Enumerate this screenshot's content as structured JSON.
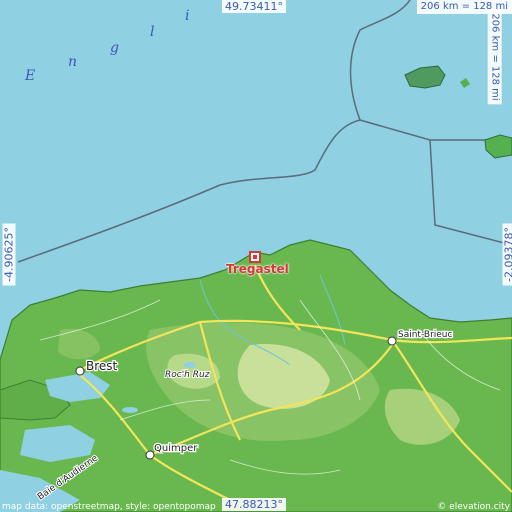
{
  "map": {
    "sea_label_letters": [
      "E",
      "n",
      "g",
      "l",
      "i"
    ],
    "coords": {
      "north": "49.73411°",
      "south": "47.88213°",
      "west": "-4.90625°",
      "east": "-2.09378°"
    },
    "scale": {
      "horizontal": "206 km = 128 mi",
      "vertical": "206 km = 128 mi"
    },
    "places": [
      {
        "name": "Brest"
      },
      {
        "name": "Quimper"
      },
      {
        "name": "Saint-Brieuc"
      },
      {
        "name": "Roc'h Ruz"
      },
      {
        "name": "Baie d'Audierne"
      }
    ],
    "highlight": {
      "name": "Tregastel"
    },
    "attribution": {
      "left": "map data: openstreetmap, style: opentopomap",
      "right": "© elevation.city"
    },
    "colors": {
      "sea": "#8fd0e2",
      "land_low": "#5fb24a",
      "land_mid": "#8cc468",
      "land_high": "#c9e09a",
      "road": "#f3e55a",
      "marker": "#d93636"
    }
  }
}
